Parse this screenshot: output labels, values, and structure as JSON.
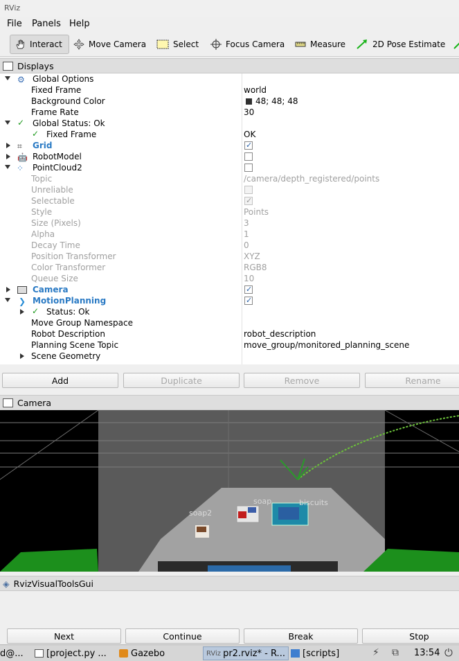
{
  "window": {
    "logo_text": "RViz"
  },
  "menubar": {
    "items": [
      "File",
      "Panels",
      "Help"
    ]
  },
  "toolbar": {
    "tools": [
      "Interact",
      "Move Camera",
      "Select",
      "Focus Camera",
      "Measure",
      "2D Pose Estimate"
    ]
  },
  "displays": {
    "panel_title": "Displays",
    "rows": [
      {
        "label": "Global Options",
        "value": ""
      },
      {
        "label": "Fixed Frame",
        "value": "world"
      },
      {
        "label": "Background Color",
        "value": "48; 48; 48"
      },
      {
        "label": "Frame Rate",
        "value": "30"
      },
      {
        "label": "Global Status: Ok",
        "value": ""
      },
      {
        "label": "Fixed Frame",
        "value": "OK"
      },
      {
        "label": "Grid",
        "value": ""
      },
      {
        "label": "RobotModel",
        "value": ""
      },
      {
        "label": "PointCloud2",
        "value": ""
      },
      {
        "label": "Topic",
        "value": "/camera/depth_registered/points"
      },
      {
        "label": "Unreliable",
        "value": ""
      },
      {
        "label": "Selectable",
        "value": ""
      },
      {
        "label": "Style",
        "value": "Points"
      },
      {
        "label": "Size (Pixels)",
        "value": "3"
      },
      {
        "label": "Alpha",
        "value": "1"
      },
      {
        "label": "Decay Time",
        "value": "0"
      },
      {
        "label": "Position Transformer",
        "value": "XYZ"
      },
      {
        "label": "Color Transformer",
        "value": "RGB8"
      },
      {
        "label": "Queue Size",
        "value": "10"
      },
      {
        "label": "Camera",
        "value": ""
      },
      {
        "label": "MotionPlanning",
        "value": ""
      },
      {
        "label": "Status: Ok",
        "value": ""
      },
      {
        "label": "Move Group Namespace",
        "value": ""
      },
      {
        "label": "Robot Description",
        "value": "robot_description"
      },
      {
        "label": "Planning Scene Topic",
        "value": "move_group/monitored_planning_scene"
      },
      {
        "label": "Scene Geometry",
        "value": ""
      }
    ],
    "checkboxes": {
      "grid": true,
      "robotmodel": false,
      "pointcloud2": false,
      "unreliable": false,
      "selectable": true,
      "camera": true,
      "motionplanning": true
    },
    "background_color_hex": "#303030",
    "buttons": [
      "Add",
      "Duplicate",
      "Remove",
      "Rename"
    ]
  },
  "camera": {
    "panel_title": "Camera",
    "labels": [
      "soap2",
      "soap",
      "biscuits"
    ]
  },
  "rviz_visual_tools": {
    "panel_title": "RvizVisualToolsGui",
    "buttons": [
      "Next",
      "Continue",
      "Break",
      "Stop"
    ]
  },
  "taskbar": {
    "items": [
      "d@...",
      "[project.py ...",
      "Gazebo",
      "pr2.rviz* - R...",
      "[scripts]"
    ],
    "clock": "13:54"
  },
  "colors": {
    "accent_blue": "#2a7ac4",
    "ok_green": "#1f9a1f"
  }
}
